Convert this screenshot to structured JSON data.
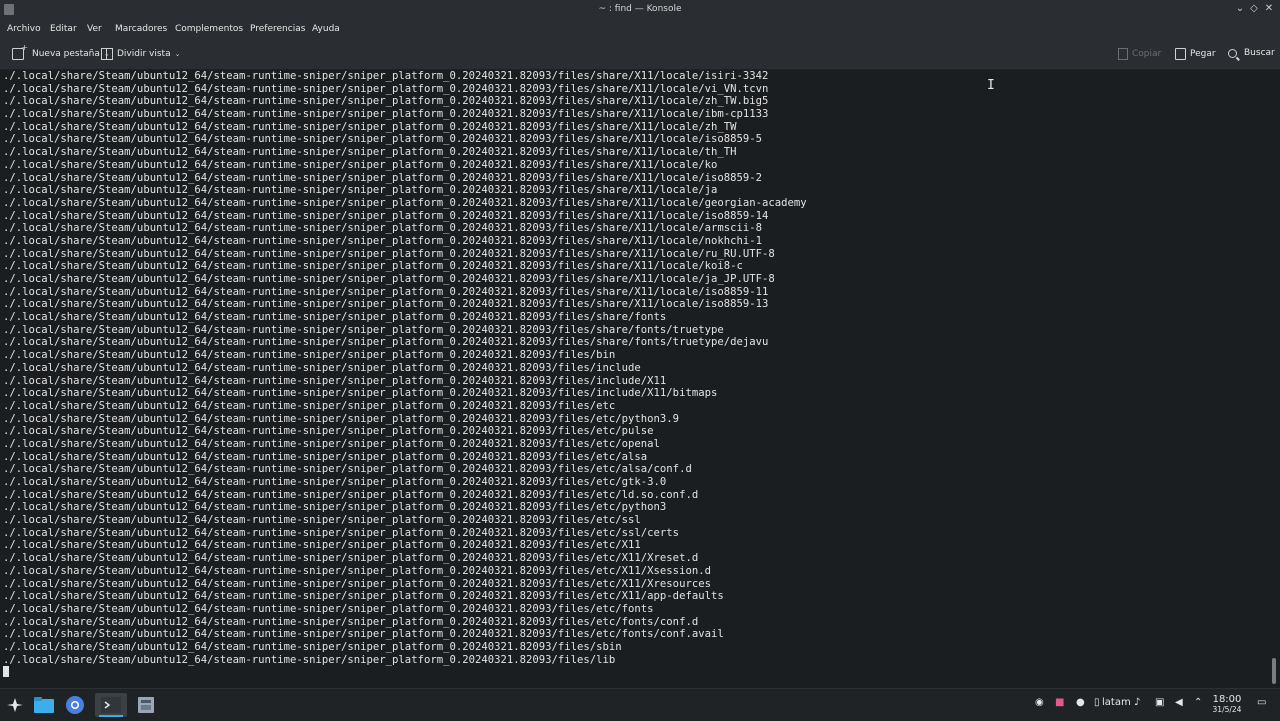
{
  "window": {
    "title": "~ : find — Konsole"
  },
  "menu": [
    "Archivo",
    "Editar",
    "Ver",
    "Marcadores",
    "Complementos",
    "Preferencias",
    "Ayuda"
  ],
  "toolbar": {
    "new_tab": "Nueva pestaña",
    "split_view": "Dividir vista",
    "copy": "Copiar",
    "paste": "Pegar",
    "search": "Buscar"
  },
  "terminal": {
    "prefix": "./.local/share/Steam/ubuntu12_64/steam-runtime-sniper/sniper_platform_0.20240321.82093/files/",
    "lines": [
      "share/X11/locale/isiri-3342",
      "share/X11/locale/vi_VN.tcvn",
      "share/X11/locale/zh_TW.big5",
      "share/X11/locale/ibm-cp1133",
      "share/X11/locale/zh_TW",
      "share/X11/locale/iso8859-5",
      "share/X11/locale/th_TH",
      "share/X11/locale/ko",
      "share/X11/locale/iso8859-2",
      "share/X11/locale/ja",
      "share/X11/locale/georgian-academy",
      "share/X11/locale/iso8859-14",
      "share/X11/locale/armscii-8",
      "share/X11/locale/nokhchi-1",
      "share/X11/locale/ru_RU.UTF-8",
      "share/X11/locale/koi8-c",
      "share/X11/locale/ja_JP.UTF-8",
      "share/X11/locale/iso8859-11",
      "share/X11/locale/iso8859-13",
      "share/fonts",
      "share/fonts/truetype",
      "share/fonts/truetype/dejavu",
      "bin",
      "include",
      "include/X11",
      "include/X11/bitmaps",
      "etc",
      "etc/python3.9",
      "etc/pulse",
      "etc/openal",
      "etc/alsa",
      "etc/alsa/conf.d",
      "etc/gtk-3.0",
      "etc/ld.so.conf.d",
      "etc/python3",
      "etc/ssl",
      "etc/ssl/certs",
      "etc/X11",
      "etc/X11/Xreset.d",
      "etc/X11/Xsession.d",
      "etc/X11/Xresources",
      "etc/X11/app-defaults",
      "etc/fonts",
      "etc/fonts/conf.d",
      "etc/fonts/conf.avail",
      "sbin",
      "lib"
    ]
  },
  "taskbar": {
    "keyboard_layout": "latam",
    "time": "18:00",
    "date": "31/5/24"
  },
  "colors": {
    "accent": "#3daee9",
    "terminal_bg": "#1b1e20",
    "bar_bg": "#2a2e32"
  },
  "icons": [
    "application-launcher-icon",
    "file-manager-icon",
    "browser-icon",
    "terminal-icon",
    "app-icon"
  ]
}
